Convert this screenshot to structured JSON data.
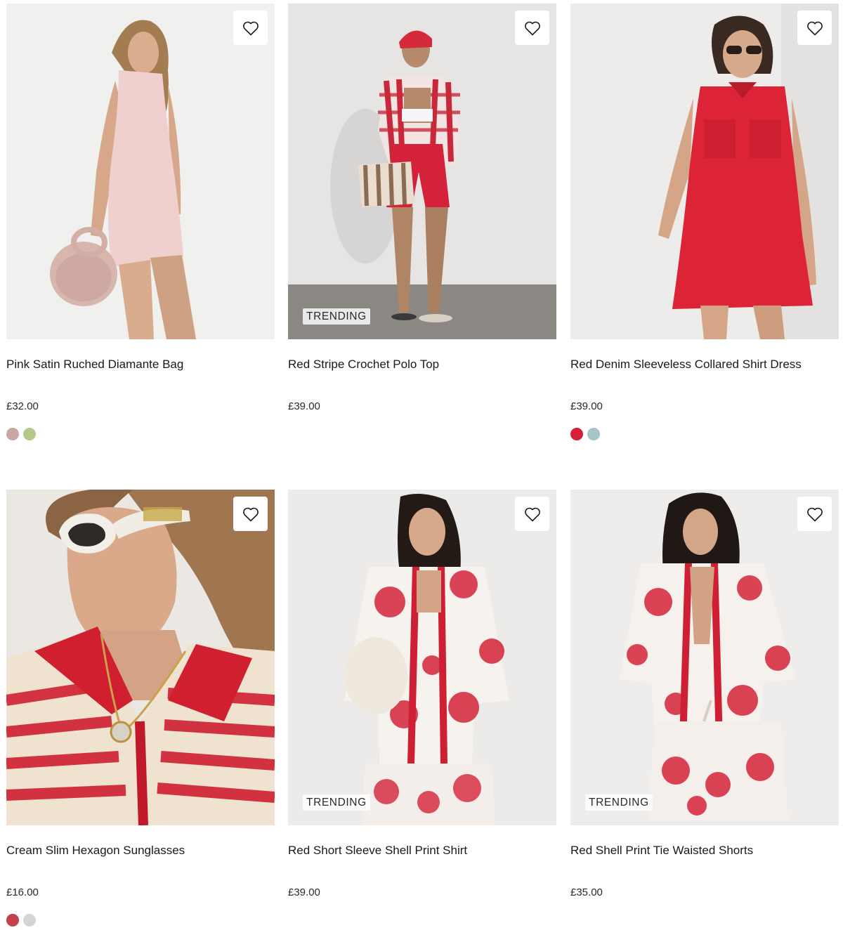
{
  "wishlist_icon": "heart-outline-icon",
  "products": [
    {
      "name": "Pink Satin Ruched Diamante Bag",
      "price": "£32.00",
      "badge": "",
      "swatches": [
        {
          "color": "#c9a8a0",
          "label": "pink"
        },
        {
          "color": "#b5c98a",
          "label": "green"
        }
      ]
    },
    {
      "name": "Red Stripe Crochet Polo Top",
      "price": "£39.00",
      "badge": "TRENDING",
      "swatches": []
    },
    {
      "name": "Red Denim Sleeveless Collared Shirt Dress",
      "price": "£39.00",
      "badge": "",
      "swatches": [
        {
          "color": "#d6203a",
          "label": "red"
        },
        {
          "color": "#a6c4cc",
          "label": "blue"
        }
      ]
    },
    {
      "name": "Cream Slim Hexagon Sunglasses",
      "price": "£16.00",
      "badge": "",
      "swatches": [
        {
          "color": "#c4404c",
          "label": "print"
        },
        {
          "color": "#d4d4d4",
          "label": "grey"
        }
      ]
    },
    {
      "name": "Red Short Sleeve Shell Print Shirt",
      "price": "£39.00",
      "badge": "TRENDING",
      "swatches": []
    },
    {
      "name": "Red Shell Print Tie Waisted Shorts",
      "price": "£35.00",
      "badge": "TRENDING",
      "swatches": []
    }
  ]
}
